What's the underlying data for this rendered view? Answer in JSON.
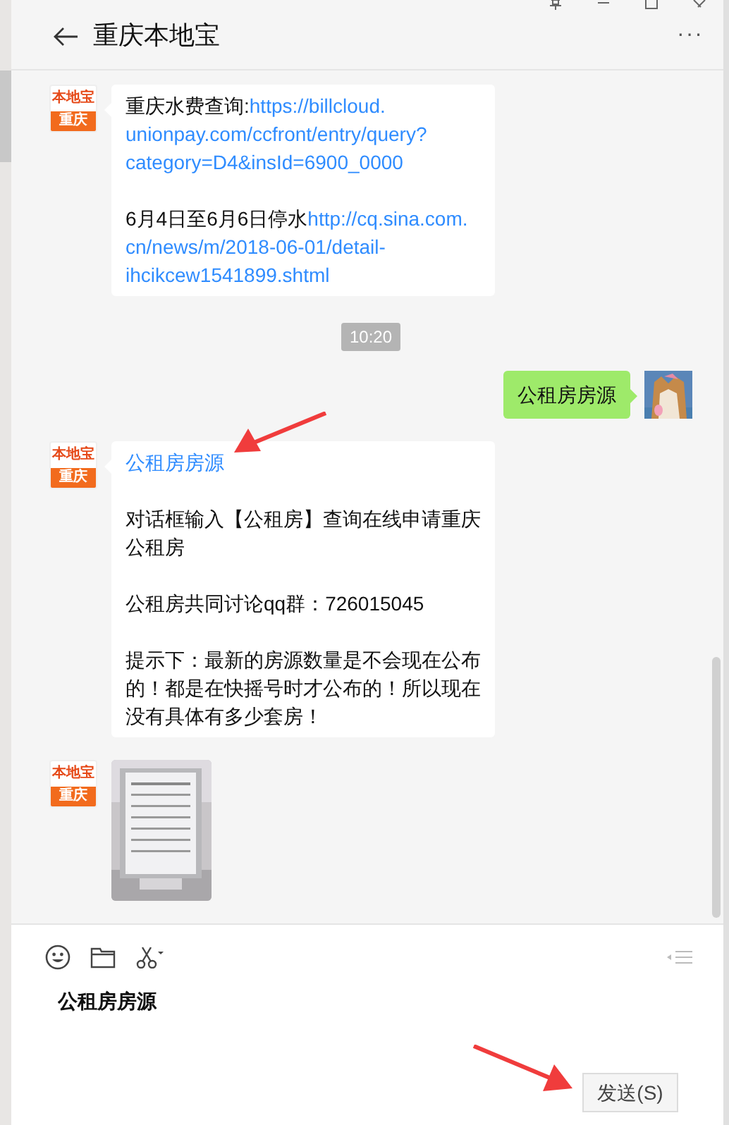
{
  "window": {
    "title": "重庆本地宝",
    "more": "···"
  },
  "messages": [
    {
      "kind": "text",
      "outgoing": false,
      "avatar": {
        "logo": "本地宝",
        "city": "重庆"
      },
      "paragraphs": [
        [
          [
            {
              "text": "重庆水费查询:",
              "link": false
            },
            {
              "text": "https://billcloud.",
              "link": true
            }
          ],
          [
            {
              "text": "unionpay.com/ccfront/entry/query?",
              "link": true
            }
          ],
          [
            {
              "text": "category=D4&insId=6900_0000",
              "link": true
            }
          ]
        ],
        [
          [
            {
              "text": "6月4日至6月6日停水",
              "link": false
            },
            {
              "text": "http://cq.sina.com.",
              "link": true
            }
          ],
          [
            {
              "text": "cn/news/m/2018-06-01/detail-",
              "link": true
            }
          ],
          [
            {
              "text": "ihcikcew1541899.shtml",
              "link": true
            }
          ]
        ]
      ]
    },
    {
      "kind": "time",
      "text": "10:20"
    },
    {
      "kind": "text",
      "outgoing": true,
      "paragraphs": [
        [
          [
            {
              "text": "公租房房源",
              "link": false
            }
          ]
        ]
      ]
    },
    {
      "kind": "text",
      "outgoing": false,
      "avatar": {
        "logo": "本地宝",
        "city": "重庆"
      },
      "paragraphs": [
        [
          [
            {
              "text": "公租房房源",
              "link": true
            }
          ]
        ],
        [
          [
            {
              "text": "对话框输入【公租房】查询在线申请重庆",
              "link": false
            }
          ],
          [
            {
              "text": "公租房",
              "link": false
            }
          ]
        ],
        [
          [
            {
              "text": "公租房共同讨论qq群：726015045",
              "link": false
            }
          ]
        ],
        [
          [
            {
              "text": "提示下：最新的房源数量是不会现在公布",
              "link": false
            }
          ],
          [
            {
              "text": "的！都是在快摇号时才公布的！所以现在",
              "link": false
            }
          ],
          [
            {
              "text": "没有具体有多少套房！",
              "link": false
            }
          ]
        ]
      ]
    },
    {
      "outgoing": false,
      "avatar": {
        "logo": "本地宝",
        "city": "重庆"
      }
    }
  ],
  "composer": {
    "value": "公租房房源",
    "send_button": "发送(S)"
  }
}
